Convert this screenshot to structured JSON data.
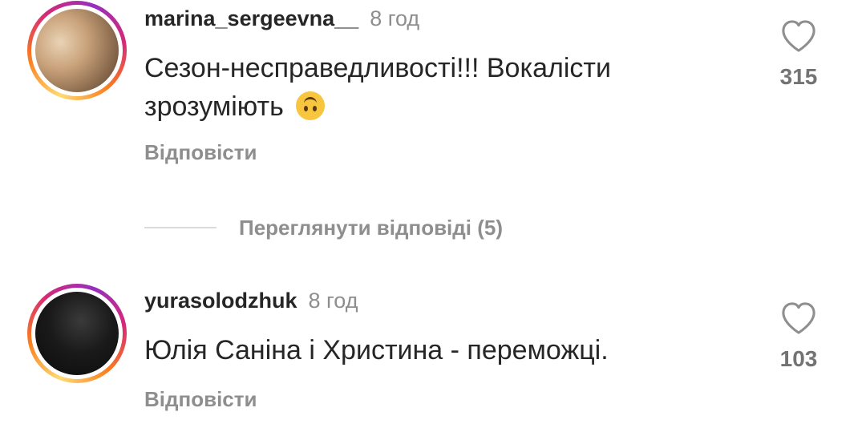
{
  "comments": [
    {
      "username": "marina_sergeevna__",
      "time": "8 год",
      "text": "Сезон-несправедливості!!! Вокалісти зрозуміють",
      "emoji": "upside-down-face",
      "reply_label": "Відповісти",
      "likes": "315"
    },
    {
      "username": "yurasolodzhuk",
      "time": "8 год",
      "text": "Юлія Саніна і Христина - переможці.",
      "reply_label": "Відповісти",
      "likes": "103"
    }
  ],
  "view_replies": {
    "label": "Переглянути відповіді (5)"
  },
  "colors": {
    "text": "#262626",
    "muted": "#8e8e8e",
    "divider": "#dbdbdb",
    "story_ring": [
      "#feda75",
      "#fa7e1e",
      "#d62976",
      "#962fbf"
    ]
  }
}
